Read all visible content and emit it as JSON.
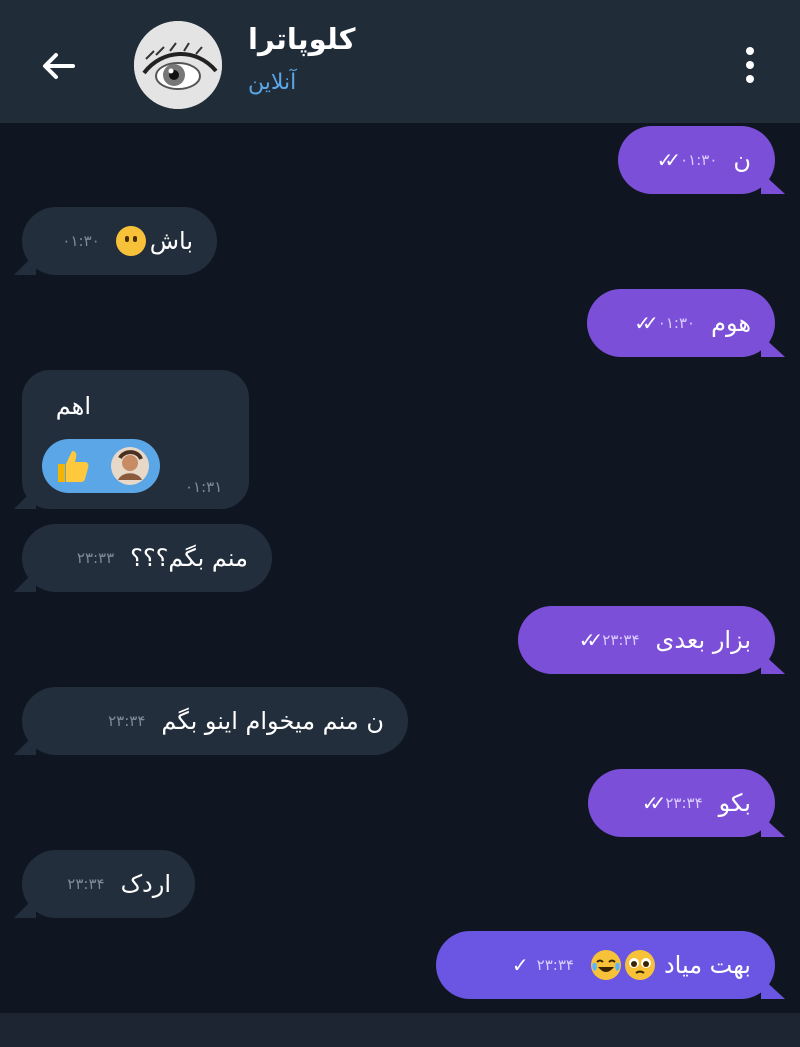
{
  "header": {
    "contact_name": "کلوپاترا",
    "status": "آنلاین"
  },
  "messages": [
    {
      "dir": "out",
      "text": "ن",
      "time": "۰۱:۳۰",
      "read": true
    },
    {
      "dir": "in",
      "text": "باش",
      "emoji": "confused-face",
      "time": "۰۱:۳۰"
    },
    {
      "dir": "out",
      "text": "هوم",
      "time": "۰۱:۳۰",
      "read": true
    },
    {
      "dir": "in",
      "text": "اهم",
      "time": "۰۱:۳۱",
      "reaction": "thumbs-up"
    },
    {
      "dir": "in",
      "text": "منم بگم؟؟؟",
      "time": "۲۳:۳۳"
    },
    {
      "dir": "out",
      "text": "بزار بعدی",
      "time": "۲۳:۳۴",
      "read": true
    },
    {
      "dir": "in",
      "text": "ن منم میخوام اینو بگم",
      "time": "۲۳:۳۴"
    },
    {
      "dir": "out",
      "text": "بکو",
      "time": "۲۳:۳۴",
      "read": true
    },
    {
      "dir": "in",
      "text": "اردک",
      "time": "۲۳:۳۴"
    },
    {
      "dir": "out",
      "text": "بهت میاد",
      "emoji": "pleading-face, tears-of-joy",
      "time": "۲۳:۳۴",
      "read": false
    }
  ],
  "colors": {
    "background": "#0f1621",
    "header": "#212c39",
    "incoming_bubble": "#232e3c",
    "outgoing_bubble": "#7c4fd8",
    "status_blue": "#5aa6e6"
  }
}
